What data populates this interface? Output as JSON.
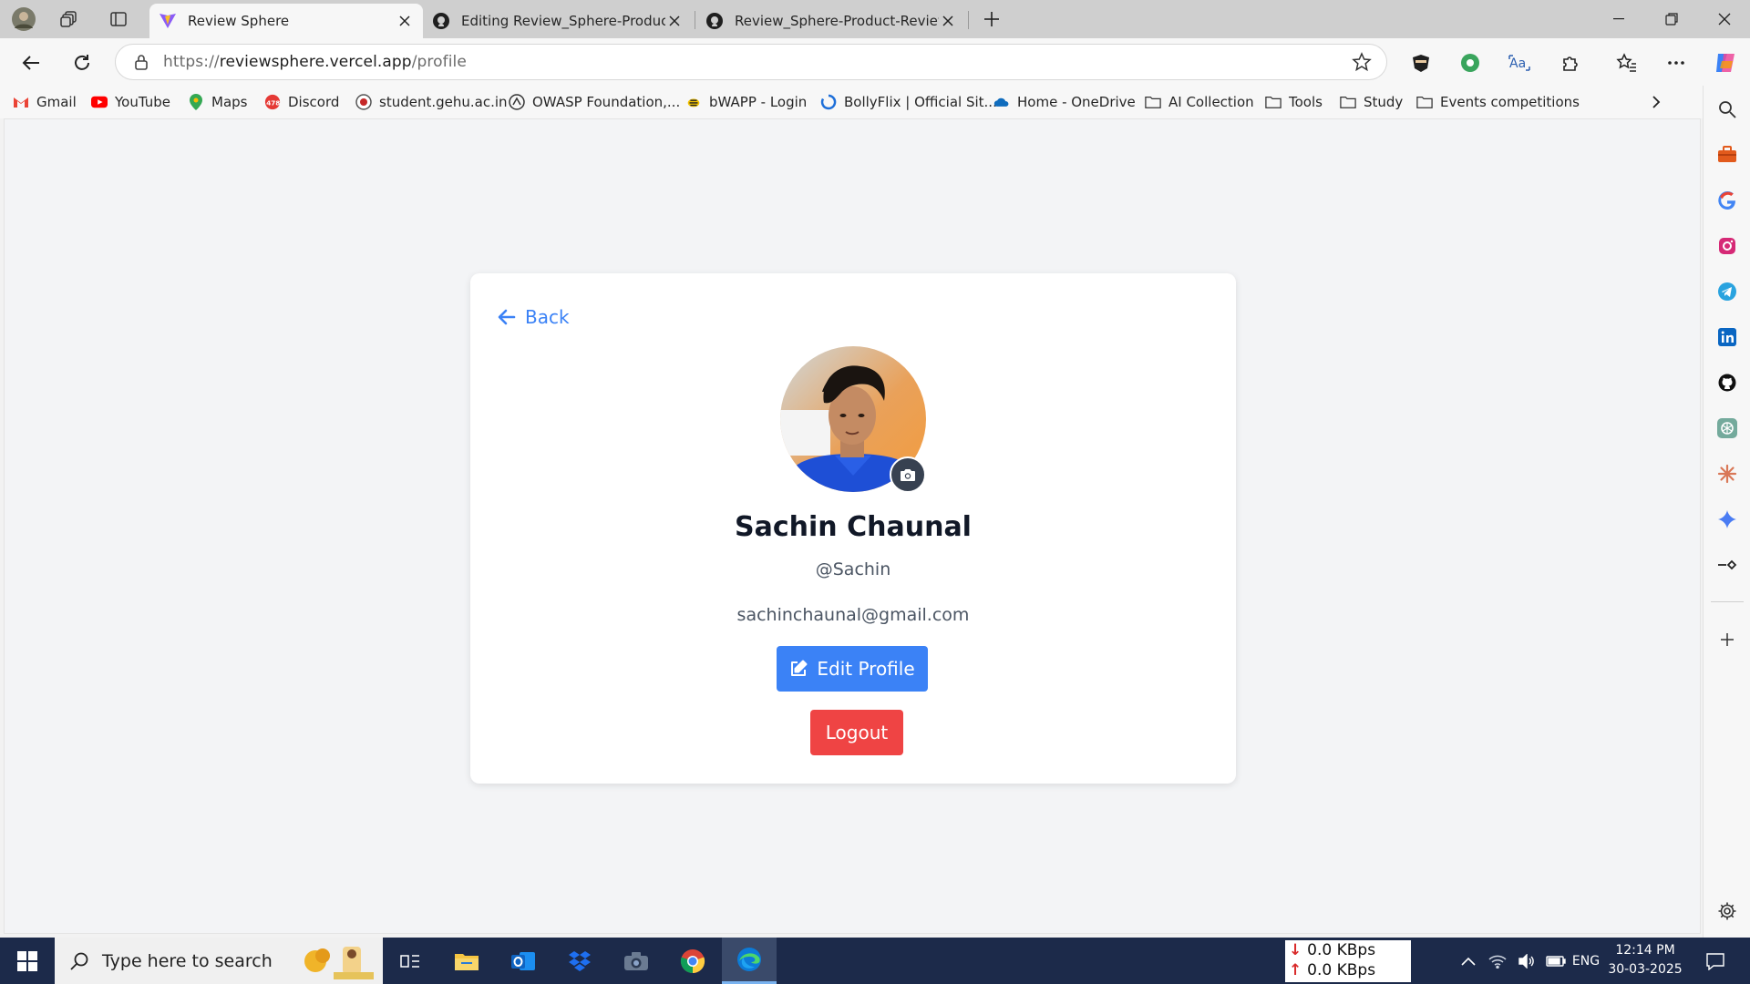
{
  "browser": {
    "tabs": [
      {
        "title": "Review Sphere",
        "active": true
      },
      {
        "title": "Editing Review_Sphere-Product-Review",
        "active": false
      },
      {
        "title": "Review_Sphere-Product-Review-System",
        "active": false
      }
    ],
    "url_scheme": "https://",
    "url_host": "reviewsphere.vercel.app",
    "url_path": "/profile"
  },
  "bookmarks": [
    {
      "label": "Gmail",
      "icon": "gmail-icon"
    },
    {
      "label": "YouTube",
      "icon": "youtube-icon"
    },
    {
      "label": "Maps",
      "icon": "maps-icon"
    },
    {
      "label": "Discord",
      "icon": "discord-icon",
      "badge": "478"
    },
    {
      "label": "student.gehu.ac.in",
      "icon": "gehu-icon"
    },
    {
      "label": "OWASP Foundation,...",
      "icon": "owasp-icon"
    },
    {
      "label": "bWAPP - Login",
      "icon": "bwapp-icon"
    },
    {
      "label": "BollyFlix | Official Sit...",
      "icon": "bollyflix-icon"
    },
    {
      "label": "Home - OneDrive",
      "icon": "onedrive-icon"
    },
    {
      "label": "AI Collection",
      "icon": "folder-icon"
    },
    {
      "label": "Tools",
      "icon": "folder-icon"
    },
    {
      "label": "Study",
      "icon": "folder-icon"
    },
    {
      "label": "Events competitions",
      "icon": "folder-icon"
    }
  ],
  "profile": {
    "back_label": "Back",
    "name": "Sachin Chaunal",
    "username": "@Sachin",
    "email": "sachinchaunal@gmail.com",
    "edit_label": "Edit Profile",
    "logout_label": "Logout"
  },
  "taskbar": {
    "search_placeholder": "Type here to search",
    "net_down": "0.0 KBps",
    "net_up": "0.0 KBps",
    "language": "ENG",
    "time": "12:14 PM",
    "date": "30-03-2025"
  },
  "colors": {
    "accent_blue": "#3b82f6",
    "logout_red": "#ef4444",
    "taskbar": "#1c2a4a"
  }
}
